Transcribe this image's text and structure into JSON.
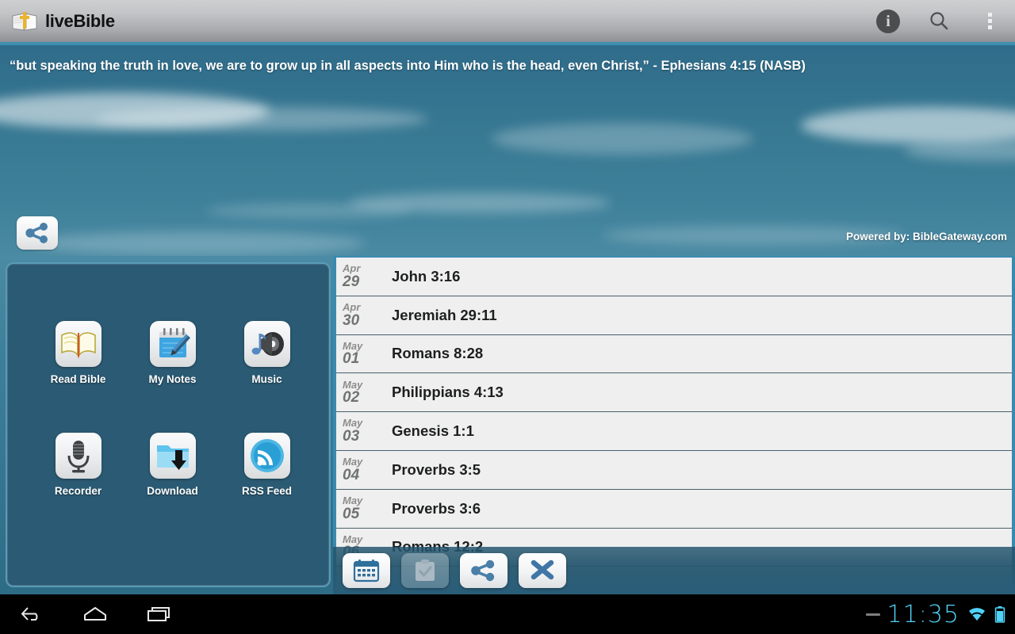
{
  "app": {
    "title": "liveBible",
    "logo_icon": "bible-cross-icon"
  },
  "action_bar": {
    "info_label": "i",
    "info_icon": "info-icon",
    "search_icon": "search-icon",
    "overflow_icon": "overflow-menu-icon"
  },
  "banner": {
    "verse": "“but speaking the truth in love, we are to grow up in all aspects into Him who is the head, even Christ,” - Ephesians 4:15 (NASB)",
    "powered_by": "Powered by: BibleGateway.com",
    "share_icon": "share-icon",
    "sky_color": "#3a7f99"
  },
  "launcher": {
    "items": [
      {
        "label": "Read Bible",
        "icon": "open-book-icon"
      },
      {
        "label": "My Notes",
        "icon": "notepad-pencil-icon"
      },
      {
        "label": "Music",
        "icon": "speaker-music-note-icon"
      },
      {
        "label": "Recorder",
        "icon": "microphone-icon"
      },
      {
        "label": "Download",
        "icon": "folder-download-icon"
      },
      {
        "label": "RSS Feed",
        "icon": "rss-feed-icon"
      }
    ]
  },
  "verse_list": {
    "rows": [
      {
        "month": "Apr",
        "day": "29",
        "reference": "John 3:16"
      },
      {
        "month": "Apr",
        "day": "30",
        "reference": "Jeremiah 29:11"
      },
      {
        "month": "May",
        "day": "01",
        "reference": "Romans 8:28"
      },
      {
        "month": "May",
        "day": "02",
        "reference": "Philippians 4:13"
      },
      {
        "month": "May",
        "day": "03",
        "reference": "Genesis 1:1"
      },
      {
        "month": "May",
        "day": "04",
        "reference": "Proverbs 3:5"
      },
      {
        "month": "May",
        "day": "05",
        "reference": "Proverbs 3:6"
      },
      {
        "month": "May",
        "day": "06",
        "reference": "Romans 12:2"
      }
    ]
  },
  "bottom_toolbar": {
    "buttons": [
      {
        "name": "calendar",
        "icon": "calendar-icon",
        "enabled": true
      },
      {
        "name": "clipboard-check",
        "icon": "clipboard-check-icon",
        "enabled": false
      },
      {
        "name": "share",
        "icon": "share-icon",
        "enabled": true
      },
      {
        "name": "close",
        "icon": "close-x-icon",
        "enabled": true
      }
    ]
  },
  "system_bar": {
    "back_icon": "back-icon",
    "home_icon": "home-icon",
    "recents_icon": "recents-icon",
    "notification_icon": "notification-dash-icon",
    "clock": "11:35",
    "wifi_icon": "wifi-icon",
    "battery_icon": "battery-icon",
    "clock_color": "#4fd2f7"
  }
}
